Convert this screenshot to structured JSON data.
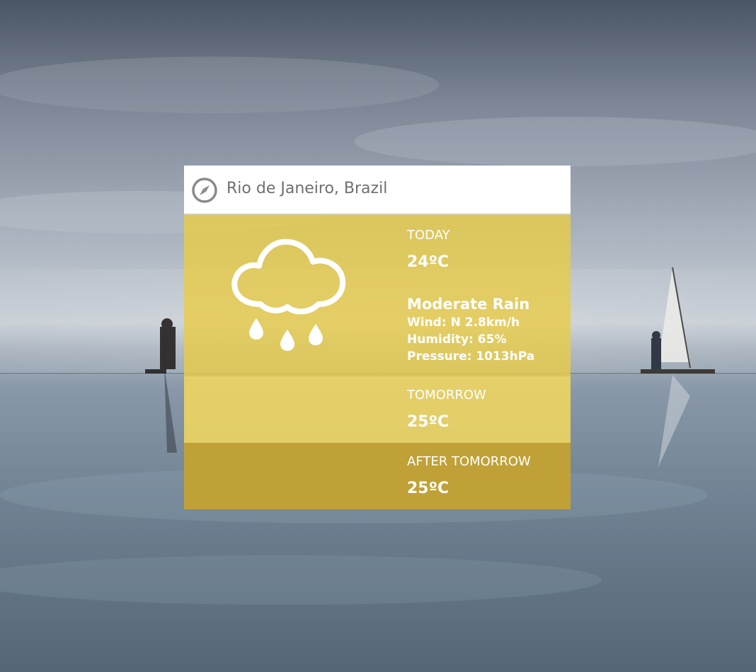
{
  "location": {
    "name": "Rio de Janeiro, Brazil",
    "icon": "compass-icon"
  },
  "today": {
    "label": "TODAY",
    "temperature": "24ºC",
    "condition": "Moderate Rain",
    "wind": "Wind: N 2.8km/h",
    "humidity": "Humidity: 65%",
    "pressure": "Pressure: 1013hPa",
    "icon": "cloud-rain-icon"
  },
  "tomorrow": {
    "label": "TOMORROW",
    "temperature": "25ºC"
  },
  "after_tomorrow": {
    "label": "AFTER TOMORROW",
    "temperature": "25ºC"
  },
  "colors": {
    "today_panel": "#e8cc4a",
    "tomorrow_panel": "#f0d660",
    "after_tomorrow_panel": "#c4a232",
    "header": "#ffffff",
    "text": "#ffffff"
  }
}
